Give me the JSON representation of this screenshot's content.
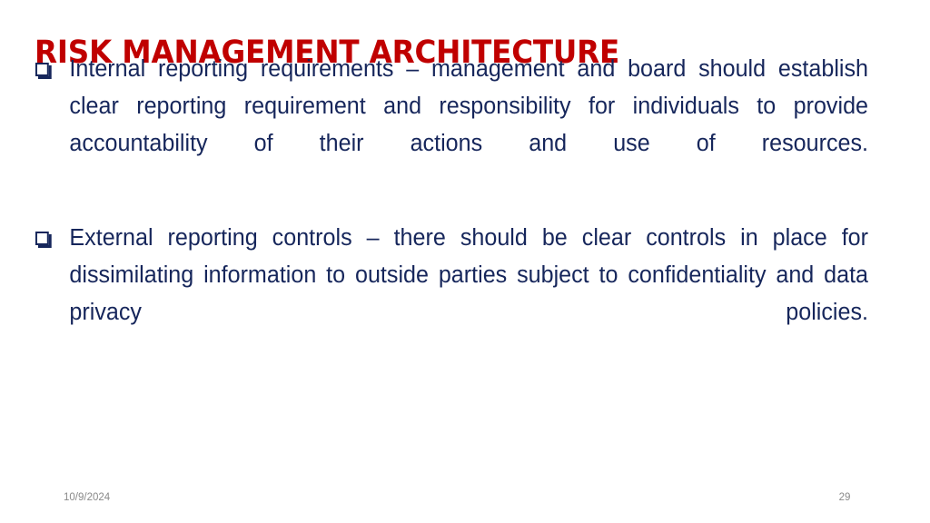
{
  "slide": {
    "background_color": "#FFFFFF",
    "title": "RISK MANAGEMENT ARCHITECTURE",
    "title_color": "#C00000",
    "body_color": "#16265B",
    "footer_color": "#8A8A8A"
  },
  "body": {
    "bullet_glyph": "hollow-square",
    "paragraphs": [
      {
        "text": "Internal reporting requirements – management and board should establish clear reporting requirement and responsibility for individuals to provide accountability of their actions and use of resources."
      },
      {
        "text": "External reporting controls – there should be clear controls in place for dissimilating information to outside parties subject to confidentiality and data privacy policies."
      }
    ]
  },
  "footer": {
    "date": "10/9/2024",
    "page_number": "29"
  }
}
